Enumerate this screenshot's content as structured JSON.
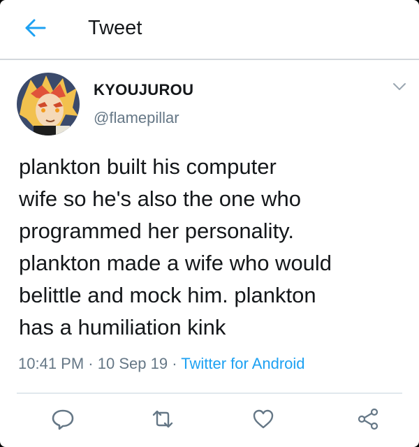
{
  "header": {
    "title": "Tweet",
    "back_icon": "arrow-left-icon",
    "accent_color": "#1da1f2"
  },
  "tweet": {
    "display_name": "KYOUJUROU",
    "handle": "@flamepillar",
    "text_lines": [
      "plankton built his computer",
      "wife so he's also the one who",
      "programmed her personality.",
      "plankton made a wife who would",
      "belittle and mock him. plankton",
      "has a humiliation kink"
    ],
    "time": "10:41 PM",
    "date": "10 Sep 19",
    "separator": "·",
    "source": "Twitter for Android"
  },
  "actions": {
    "reply_icon": "reply-icon",
    "retweet_icon": "retweet-icon",
    "like_icon": "heart-icon",
    "share_icon": "share-icon"
  },
  "colors": {
    "text_primary": "#14171a",
    "text_secondary": "#657786",
    "link": "#1da1f2",
    "divider": "#e1e8ed"
  }
}
